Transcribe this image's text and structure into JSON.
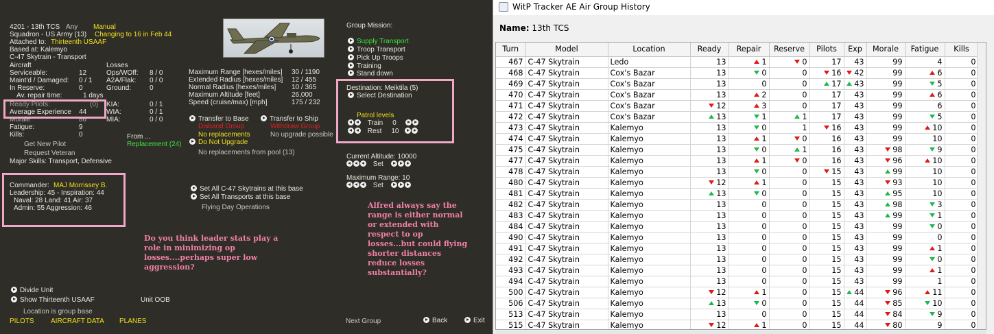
{
  "game": {
    "unit_line": "4201 - 13th TCS",
    "any_label": "Any",
    "manual_label": "Manual",
    "squadron_line": "Squadron - US Army (13)",
    "changing_text": "Changing to 16 in Feb 44",
    "attached_label": "Attached to:",
    "attached_value": "Thirteenth USAAF",
    "based_line": "Based at: Kalemyo",
    "aircraft_type": "C-47 Skytrain - Transport",
    "aircraft_header": "Aircraft",
    "losses_header": "Losses",
    "stats_left": [
      {
        "label": "Serviceable:",
        "value": "12"
      },
      {
        "label": "Maint'd / Damaged:",
        "value": "0 / 1"
      },
      {
        "label": "In Reserve:",
        "value": "0"
      },
      {
        "label": "Av. repair time:",
        "value": "1 days"
      }
    ],
    "stats_losses": [
      {
        "label": "Ops/WOff:",
        "value": "8 / 0"
      },
      {
        "label": "A2A/Flak:",
        "value": "0 / 0"
      },
      {
        "label": "Ground:",
        "value": "0"
      }
    ],
    "ready_pilots_label": "Ready Pilots:",
    "ready_pilots_value": "(0)",
    "avg_exp_label": "Average Experience",
    "avg_exp_value": "44",
    "kia_label": "KIA:",
    "kia_value": "0 / 1",
    "wia_label": "WIA:",
    "wia_value": "0 / 1",
    "mia_label": "MIA:",
    "mia_value": "0 / 0",
    "morale_label": "Morale",
    "morale_value": "86",
    "fatigue_label": "Fatigue:",
    "fatigue_value": "9",
    "kills_label": "Kills:",
    "kills_value": "0",
    "get_new_pilot": "Get New Pilot",
    "request_veteran": "Request Veteran",
    "from_label": "From ...",
    "replacement_text": "Replacement (24)",
    "major_skills": "Major Skills: Transport, Defensive",
    "commander_label": "Commander:",
    "commander_name": "MAJ Morrissey B.",
    "leadership_line": "Leadership: 45 - Inspiration: 44",
    "naval_line": "Naval: 28  Land: 41  Air: 37",
    "admin_line": "Admin: 55  Aggression: 46",
    "perf": [
      {
        "label": "Maximum Range [hexes/miles]",
        "value": "30 / 1190"
      },
      {
        "label": "Extended Radius [hexes/miles]",
        "value": "12 / 455"
      },
      {
        "label": "Normal Radius [hexes/miles]",
        "value": "10 / 365"
      },
      {
        "label": "Maximum Altitude [feet]",
        "value": "26,000"
      },
      {
        "label": "Speed (cruise/max) [mph]",
        "value": "175 / 232"
      }
    ],
    "transfer_base": "Transfer to Base",
    "transfer_ship": "Transfer to Ship",
    "disband_group": "Disband Group",
    "withdraw_group": "Withdraw Group",
    "no_replacements": "No replacements",
    "no_upgrade_possible": "No upgrade possible",
    "do_not_upgrade": "Do Not Upgrade",
    "no_replacements_pool": "No replacements from pool (13)",
    "set_all_type": "Set All C-47 Skytrains at this base",
    "set_all_transports": "Set All Transports at this base",
    "flying_day_ops": "Flying Day Operations",
    "group_mission_label": "Group Mission:",
    "missions": [
      "Supply Transport",
      "Troop Transport",
      "Pick Up Troops",
      "Training",
      "Stand down"
    ],
    "destination_line": "Destination: Meiktila  (5)",
    "select_destination": "Select Destination",
    "patrol_levels": "Patrol levels",
    "train_label": "Train",
    "train_value": "0",
    "rest_label": "Rest",
    "rest_value": "10",
    "current_altitude": "Current Altitude: 10000",
    "max_range_line": "Maximum Range: 10",
    "set_label": "Set",
    "divide_unit": "Divide Unit",
    "show_hq": "Show Thirteenth USAAF",
    "unit_oob": "Unit OOB",
    "location_line": "Location is group base",
    "bottom_tabs": [
      "PILOTS",
      "AIRCRAFT DATA",
      "PLANES"
    ],
    "next_group": "Next Group",
    "back_label": "Back",
    "exit_label": "Exit",
    "note_left": "Do you think leader stats play a role in minimizing op losses....perhaps super low aggression?",
    "note_right": "Alfred always say the range is either normal or extended with respect to op losses...but could flying shorter distances reduce losses substantially?"
  },
  "tracker": {
    "window_title": "WitP Tracker AE Air Group History",
    "name_label": "Name:",
    "name_value": "13th TCS",
    "columns": [
      "Turn",
      "Model",
      "Location",
      "Ready",
      "Repair",
      "Reserve",
      "Pilots",
      "Exp",
      "Morale",
      "Fatigue",
      "Kills"
    ],
    "rows": [
      {
        "turn": "467",
        "model": "C-47 Skytrain",
        "loc": "Ledo",
        "ready": "13",
        "ready_a": "",
        "repair": "1",
        "repair_a": "up",
        "reserve": "0",
        "reserve_a": "dn",
        "pilots": "17",
        "pilots_a": "",
        "exp": "43",
        "exp_a": "",
        "morale": "99",
        "morale_a": "",
        "fatigue": "4",
        "fatigue_a": "",
        "kills": "0"
      },
      {
        "turn": "468",
        "model": "C-47 Skytrain",
        "loc": "Cox's Bazar",
        "ready": "13",
        "ready_a": "",
        "repair": "0",
        "repair_a": "dng",
        "reserve": "0",
        "reserve_a": "",
        "pilots": "16",
        "pilots_a": "dn",
        "exp": "42",
        "exp_a": "dn",
        "morale": "99",
        "morale_a": "",
        "fatigue": "6",
        "fatigue_a": "up",
        "kills": "0"
      },
      {
        "turn": "469",
        "model": "C-47 Skytrain",
        "loc": "Cox's Bazar",
        "ready": "13",
        "ready_a": "",
        "repair": "0",
        "repair_a": "",
        "reserve": "0",
        "reserve_a": "",
        "pilots": "17",
        "pilots_a": "upg",
        "exp": "43",
        "exp_a": "upg",
        "morale": "99",
        "morale_a": "",
        "fatigue": "5",
        "fatigue_a": "dng",
        "kills": "0"
      },
      {
        "turn": "470",
        "model": "C-47 Skytrain",
        "loc": "Cox's Bazar",
        "ready": "13",
        "ready_a": "",
        "repair": "2",
        "repair_a": "up",
        "reserve": "0",
        "reserve_a": "",
        "pilots": "17",
        "pilots_a": "",
        "exp": "43",
        "exp_a": "",
        "morale": "99",
        "morale_a": "",
        "fatigue": "6",
        "fatigue_a": "up",
        "kills": "0"
      },
      {
        "turn": "471",
        "model": "C-47 Skytrain",
        "loc": "Cox's Bazar",
        "ready": "12",
        "ready_a": "dn",
        "repair": "3",
        "repair_a": "up",
        "reserve": "0",
        "reserve_a": "",
        "pilots": "17",
        "pilots_a": "",
        "exp": "43",
        "exp_a": "",
        "morale": "99",
        "morale_a": "",
        "fatigue": "6",
        "fatigue_a": "",
        "kills": "0"
      },
      {
        "turn": "472",
        "model": "C-47 Skytrain",
        "loc": "Cox's Bazar",
        "ready": "13",
        "ready_a": "upg",
        "repair": "1",
        "repair_a": "dng",
        "reserve": "1",
        "reserve_a": "upg",
        "pilots": "17",
        "pilots_a": "",
        "exp": "43",
        "exp_a": "",
        "morale": "99",
        "morale_a": "",
        "fatigue": "5",
        "fatigue_a": "dng",
        "kills": "0"
      },
      {
        "turn": "473",
        "model": "C-47 Skytrain",
        "loc": "Kalemyo",
        "ready": "13",
        "ready_a": "",
        "repair": "0",
        "repair_a": "dng",
        "reserve": "1",
        "reserve_a": "",
        "pilots": "16",
        "pilots_a": "dn",
        "exp": "43",
        "exp_a": "",
        "morale": "99",
        "morale_a": "",
        "fatigue": "10",
        "fatigue_a": "up",
        "kills": "0"
      },
      {
        "turn": "474",
        "model": "C-47 Skytrain",
        "loc": "Kalemyo",
        "ready": "13",
        "ready_a": "",
        "repair": "1",
        "repair_a": "up",
        "reserve": "0",
        "reserve_a": "dn",
        "pilots": "16",
        "pilots_a": "",
        "exp": "43",
        "exp_a": "",
        "morale": "99",
        "morale_a": "",
        "fatigue": "10",
        "fatigue_a": "",
        "kills": "0"
      },
      {
        "turn": "475",
        "model": "C-47 Skytrain",
        "loc": "Kalemyo",
        "ready": "13",
        "ready_a": "",
        "repair": "0",
        "repair_a": "dng",
        "reserve": "1",
        "reserve_a": "upg",
        "pilots": "16",
        "pilots_a": "",
        "exp": "43",
        "exp_a": "",
        "morale": "98",
        "morale_a": "dn",
        "fatigue": "9",
        "fatigue_a": "dng",
        "kills": "0"
      },
      {
        "turn": "477",
        "model": "C-47 Skytrain",
        "loc": "Kalemyo",
        "ready": "13",
        "ready_a": "",
        "repair": "1",
        "repair_a": "up",
        "reserve": "0",
        "reserve_a": "dn",
        "pilots": "16",
        "pilots_a": "",
        "exp": "43",
        "exp_a": "",
        "morale": "96",
        "morale_a": "dn",
        "fatigue": "10",
        "fatigue_a": "up",
        "kills": "0"
      },
      {
        "turn": "478",
        "model": "C-47 Skytrain",
        "loc": "Kalemyo",
        "ready": "13",
        "ready_a": "",
        "repair": "0",
        "repair_a": "dng",
        "reserve": "0",
        "reserve_a": "",
        "pilots": "15",
        "pilots_a": "dn",
        "exp": "43",
        "exp_a": "",
        "morale": "99",
        "morale_a": "upg",
        "fatigue": "10",
        "fatigue_a": "",
        "kills": "0"
      },
      {
        "turn": "480",
        "model": "C-47 Skytrain",
        "loc": "Kalemyo",
        "ready": "12",
        "ready_a": "dn",
        "repair": "1",
        "repair_a": "up",
        "reserve": "0",
        "reserve_a": "",
        "pilots": "15",
        "pilots_a": "",
        "exp": "43",
        "exp_a": "",
        "morale": "93",
        "morale_a": "dn",
        "fatigue": "10",
        "fatigue_a": "",
        "kills": "0"
      },
      {
        "turn": "481",
        "model": "C-47 Skytrain",
        "loc": "Kalemyo",
        "ready": "13",
        "ready_a": "upg",
        "repair": "0",
        "repair_a": "dng",
        "reserve": "0",
        "reserve_a": "",
        "pilots": "15",
        "pilots_a": "",
        "exp": "43",
        "exp_a": "",
        "morale": "95",
        "morale_a": "upg",
        "fatigue": "10",
        "fatigue_a": "",
        "kills": "0"
      },
      {
        "turn": "482",
        "model": "C-47 Skytrain",
        "loc": "Kalemyo",
        "ready": "13",
        "ready_a": "",
        "repair": "0",
        "repair_a": "",
        "reserve": "0",
        "reserve_a": "",
        "pilots": "15",
        "pilots_a": "",
        "exp": "43",
        "exp_a": "",
        "morale": "98",
        "morale_a": "upg",
        "fatigue": "3",
        "fatigue_a": "dng",
        "kills": "0"
      },
      {
        "turn": "483",
        "model": "C-47 Skytrain",
        "loc": "Kalemyo",
        "ready": "13",
        "ready_a": "",
        "repair": "0",
        "repair_a": "",
        "reserve": "0",
        "reserve_a": "",
        "pilots": "15",
        "pilots_a": "",
        "exp": "43",
        "exp_a": "",
        "morale": "99",
        "morale_a": "upg",
        "fatigue": "1",
        "fatigue_a": "dng",
        "kills": "0"
      },
      {
        "turn": "484",
        "model": "C-47 Skytrain",
        "loc": "Kalemyo",
        "ready": "13",
        "ready_a": "",
        "repair": "0",
        "repair_a": "",
        "reserve": "0",
        "reserve_a": "",
        "pilots": "15",
        "pilots_a": "",
        "exp": "43",
        "exp_a": "",
        "morale": "99",
        "morale_a": "",
        "fatigue": "0",
        "fatigue_a": "dng",
        "kills": "0"
      },
      {
        "turn": "490",
        "model": "C-47 Skytrain",
        "loc": "Kalemyo",
        "ready": "13",
        "ready_a": "",
        "repair": "0",
        "repair_a": "",
        "reserve": "0",
        "reserve_a": "",
        "pilots": "15",
        "pilots_a": "",
        "exp": "43",
        "exp_a": "",
        "morale": "99",
        "morale_a": "",
        "fatigue": "0",
        "fatigue_a": "",
        "kills": "0"
      },
      {
        "turn": "491",
        "model": "C-47 Skytrain",
        "loc": "Kalemyo",
        "ready": "13",
        "ready_a": "",
        "repair": "0",
        "repair_a": "",
        "reserve": "0",
        "reserve_a": "",
        "pilots": "15",
        "pilots_a": "",
        "exp": "43",
        "exp_a": "",
        "morale": "99",
        "morale_a": "",
        "fatigue": "1",
        "fatigue_a": "up",
        "kills": "0"
      },
      {
        "turn": "492",
        "model": "C-47 Skytrain",
        "loc": "Kalemyo",
        "ready": "13",
        "ready_a": "",
        "repair": "0",
        "repair_a": "",
        "reserve": "0",
        "reserve_a": "",
        "pilots": "15",
        "pilots_a": "",
        "exp": "43",
        "exp_a": "",
        "morale": "99",
        "morale_a": "",
        "fatigue": "0",
        "fatigue_a": "dng",
        "kills": "0"
      },
      {
        "turn": "493",
        "model": "C-47 Skytrain",
        "loc": "Kalemyo",
        "ready": "13",
        "ready_a": "",
        "repair": "0",
        "repair_a": "",
        "reserve": "0",
        "reserve_a": "",
        "pilots": "15",
        "pilots_a": "",
        "exp": "43",
        "exp_a": "",
        "morale": "99",
        "morale_a": "",
        "fatigue": "1",
        "fatigue_a": "up",
        "kills": "0"
      },
      {
        "turn": "494",
        "model": "C-47 Skytrain",
        "loc": "Kalemyo",
        "ready": "13",
        "ready_a": "",
        "repair": "0",
        "repair_a": "",
        "reserve": "0",
        "reserve_a": "",
        "pilots": "15",
        "pilots_a": "",
        "exp": "43",
        "exp_a": "",
        "morale": "99",
        "morale_a": "",
        "fatigue": "1",
        "fatigue_a": "",
        "kills": "0"
      },
      {
        "turn": "500",
        "model": "C-47 Skytrain",
        "loc": "Kalemyo",
        "ready": "12",
        "ready_a": "dn",
        "repair": "1",
        "repair_a": "up",
        "reserve": "0",
        "reserve_a": "",
        "pilots": "15",
        "pilots_a": "",
        "exp": "44",
        "exp_a": "upg",
        "morale": "96",
        "morale_a": "dn",
        "fatigue": "11",
        "fatigue_a": "up",
        "kills": "0"
      },
      {
        "turn": "506",
        "model": "C-47 Skytrain",
        "loc": "Kalemyo",
        "ready": "13",
        "ready_a": "upg",
        "repair": "0",
        "repair_a": "dng",
        "reserve": "0",
        "reserve_a": "",
        "pilots": "15",
        "pilots_a": "",
        "exp": "44",
        "exp_a": "",
        "morale": "85",
        "morale_a": "dn",
        "fatigue": "10",
        "fatigue_a": "dng",
        "kills": "0"
      },
      {
        "turn": "513",
        "model": "C-47 Skytrain",
        "loc": "Kalemyo",
        "ready": "13",
        "ready_a": "",
        "repair": "0",
        "repair_a": "",
        "reserve": "0",
        "reserve_a": "",
        "pilots": "15",
        "pilots_a": "",
        "exp": "44",
        "exp_a": "",
        "morale": "84",
        "morale_a": "dn",
        "fatigue": "9",
        "fatigue_a": "dng",
        "kills": "0"
      },
      {
        "turn": "515",
        "model": "C-47 Skytrain",
        "loc": "Kalemyo",
        "ready": "12",
        "ready_a": "dn",
        "repair": "1",
        "repair_a": "up",
        "reserve": "0",
        "reserve_a": "",
        "pilots": "15",
        "pilots_a": "",
        "exp": "44",
        "exp_a": "",
        "morale": "80",
        "morale_a": "dn",
        "fatigue": "9",
        "fatigue_a": "",
        "kills": "0"
      }
    ]
  }
}
